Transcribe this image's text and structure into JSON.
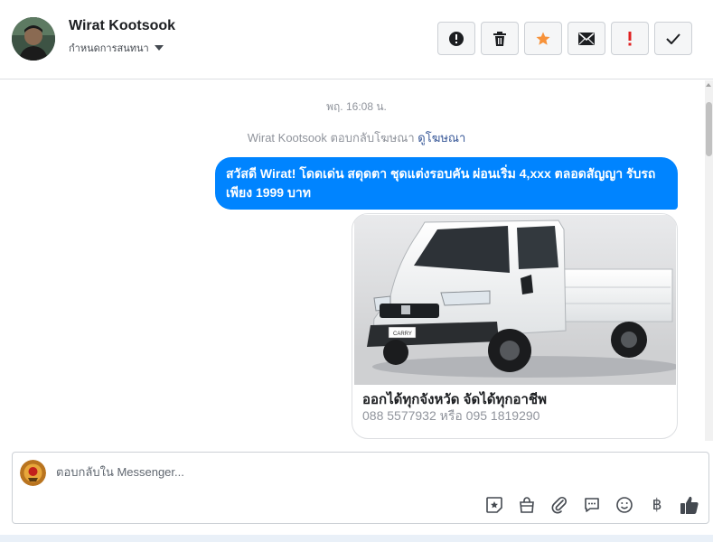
{
  "header": {
    "contact_name": "Wirat Kootsook",
    "subtitle": "กำหนดการสนทนา",
    "actions": [
      {
        "icon": "report-icon"
      },
      {
        "icon": "trash-icon"
      },
      {
        "icon": "star-icon"
      },
      {
        "icon": "mail-icon"
      },
      {
        "icon": "exclamation-icon"
      },
      {
        "icon": "check-icon"
      }
    ]
  },
  "thread": {
    "timestamp": "พฤ. 16:08 น.",
    "reply_note_prefix": "Wirat Kootsook ตอบกลับโฆษณา",
    "reply_note_link": "ดูโฆษณา",
    "message_text": "สวัสดี Wirat! โดดเด่น สดุดตา ชุดแต่งรอบคัน ผ่อนเริ่ม 4,xxx ตลอดสัญญา รับรถเพียง 1999 บาท",
    "ad_card": {
      "image_label": "CARRY",
      "title": "ออกได้ทุกจังหวัด จัดได้ทุกอาชีพ",
      "subtitle": "088 5577932 หรือ 095 1819290"
    }
  },
  "composer": {
    "placeholder": "ตอบกลับใน Messenger...",
    "tools": [
      "sticker-icon",
      "shopping-bag-icon",
      "paperclip-icon",
      "chat-bubble-icon",
      "emoji-icon",
      "baht-icon",
      "thumbs-up-icon"
    ],
    "baht_symbol": "฿"
  },
  "colors": {
    "accent": "#0084ff",
    "star": "#f7923a",
    "exclamation": "#e02020",
    "thumbs": "#444950"
  }
}
